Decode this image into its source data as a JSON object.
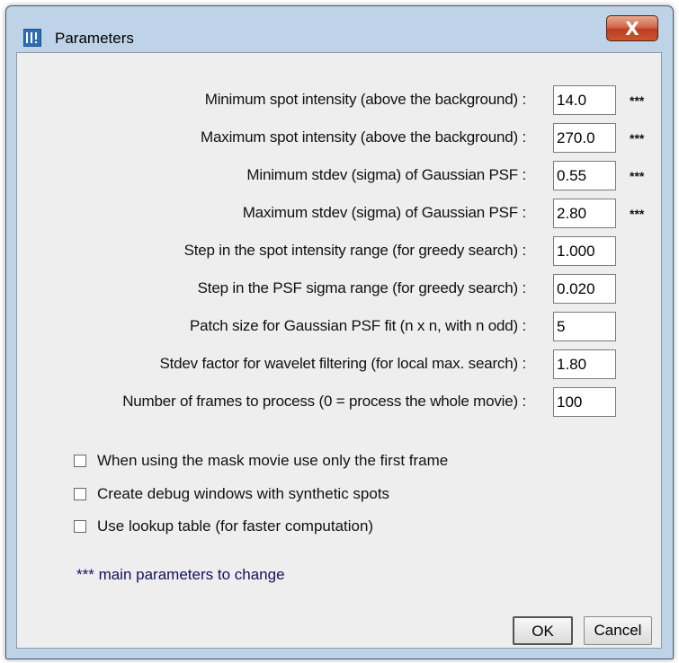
{
  "window": {
    "title": "Parameters",
    "close_label": "X"
  },
  "fields": [
    {
      "label": "Minimum spot intensity (above the background) :",
      "value": "14.0",
      "marker": "***"
    },
    {
      "label": "Maximum spot intensity (above the background) :",
      "value": "270.0",
      "marker": "***"
    },
    {
      "label": "Minimum stdev (sigma) of Gaussian PSF :",
      "value": "0.55",
      "marker": "***"
    },
    {
      "label": "Maximum stdev (sigma) of Gaussian PSF :",
      "value": "2.80",
      "marker": "***"
    },
    {
      "label": "Step in the spot intensity range (for greedy search) :",
      "value": "1.000",
      "marker": ""
    },
    {
      "label": "Step in the PSF sigma range (for greedy search) :",
      "value": "0.020",
      "marker": ""
    },
    {
      "label": "Patch size for Gaussian PSF fit (n x n, with n odd) :",
      "value": "5",
      "marker": ""
    },
    {
      "label": "Stdev factor for wavelet filtering (for local max. search) :",
      "value": "1.80",
      "marker": ""
    },
    {
      "label": "Number of frames to process (0 = process the whole movie) :",
      "value": "100",
      "marker": ""
    }
  ],
  "checkboxes": [
    {
      "label": "When using the mask movie use only the first frame",
      "checked": false
    },
    {
      "label": "Create debug windows with synthetic spots",
      "checked": false
    },
    {
      "label": "Use lookup table (for faster computation)",
      "checked": false
    }
  ],
  "note": "*** main parameters to change",
  "buttons": {
    "ok": "OK",
    "cancel": "Cancel"
  }
}
